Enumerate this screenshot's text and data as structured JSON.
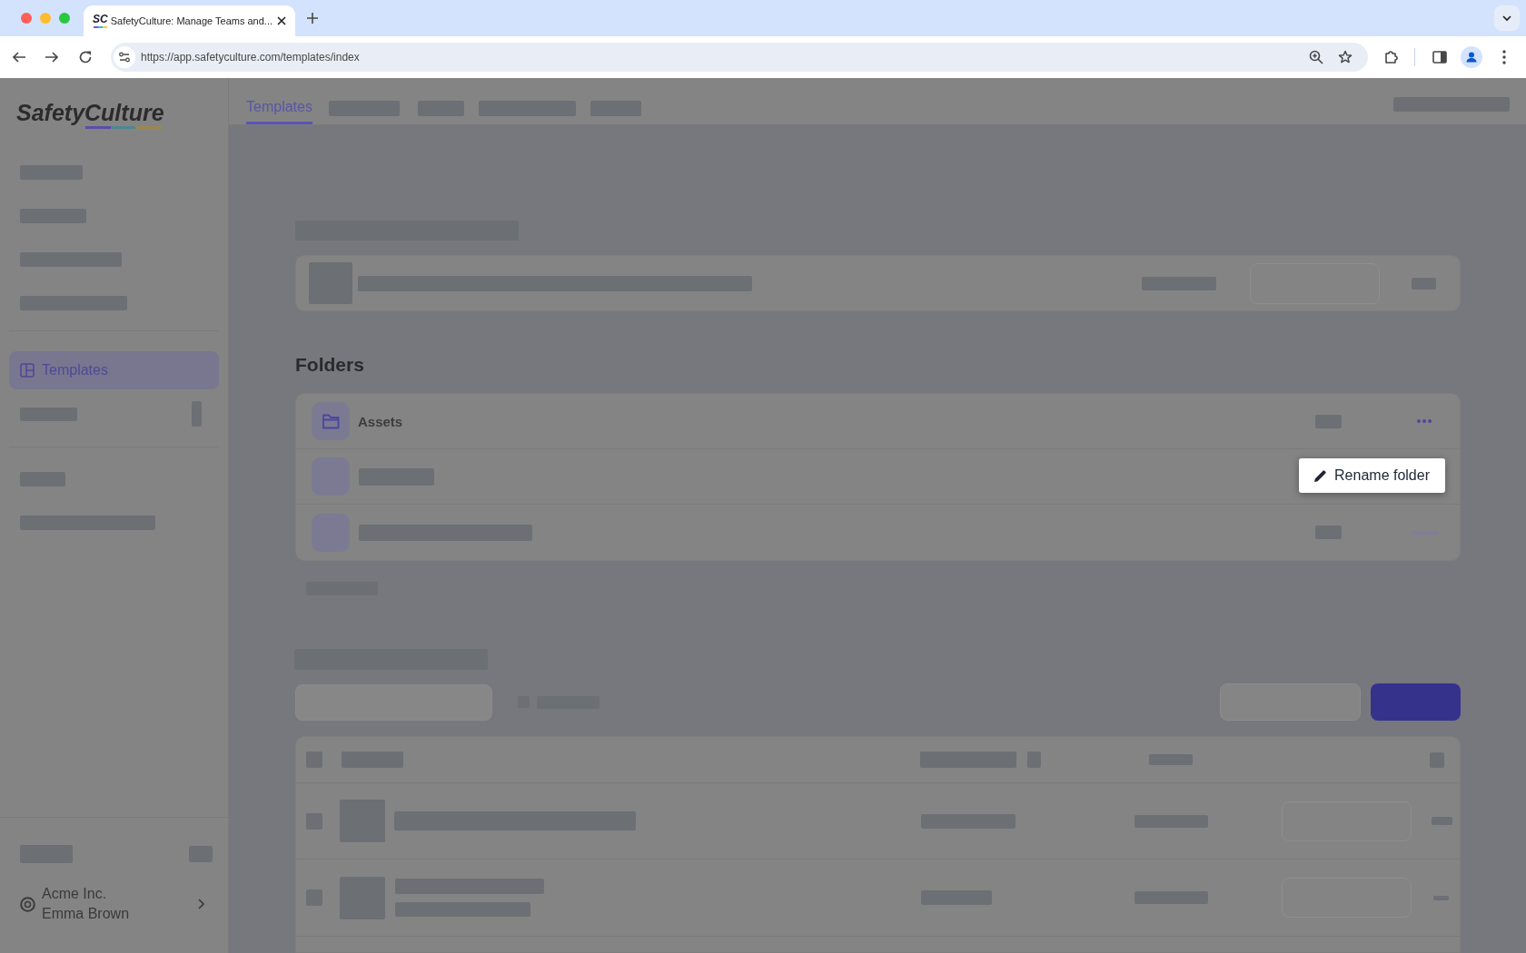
{
  "browser": {
    "favicon": "SC",
    "tab_title": "SafetyCulture: Manage Teams and...",
    "url": "https://app.safetyculture.com/templates/index"
  },
  "sidebar": {
    "logo": "SafetyCulture",
    "nav_items": [
      {
        "label": "Templates",
        "selected": true
      }
    ],
    "organization": {
      "name": "Acme Inc.",
      "user": "Emma Brown"
    }
  },
  "tabs": [
    {
      "label": "Templates",
      "selected": true
    }
  ],
  "folders": {
    "title": "Folders",
    "items": [
      {
        "name": "Assets"
      }
    ]
  },
  "context_menu": {
    "items": [
      {
        "label": "Rename folder"
      }
    ]
  }
}
